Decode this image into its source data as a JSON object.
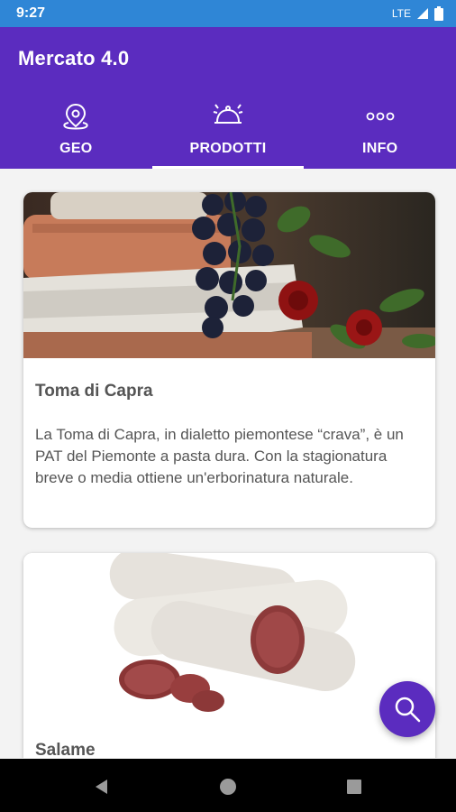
{
  "status": {
    "time": "9:27",
    "network": "LTE"
  },
  "app": {
    "title": "Mercato 4.0"
  },
  "tabs": [
    {
      "label": "GEO",
      "icon": "map-pin-icon",
      "active": false
    },
    {
      "label": "PRODOTTI",
      "icon": "serving-cloche-icon",
      "active": true
    },
    {
      "label": "INFO",
      "icon": "more-dots-icon",
      "active": false
    }
  ],
  "products": [
    {
      "name": "Toma di Capra",
      "description": "La Toma di Capra, in dialetto piemontese “crava”, è un PAT del Piemonte a pasta dura. Con la stagionatura breve o media ottiene un'erborinatura naturale."
    },
    {
      "name": "Salame",
      "description": ""
    }
  ],
  "fab": {
    "icon": "search-icon"
  },
  "colors": {
    "primary": "#5b2cbf",
    "statusbar": "#2f86d6",
    "card_text": "#555555"
  }
}
